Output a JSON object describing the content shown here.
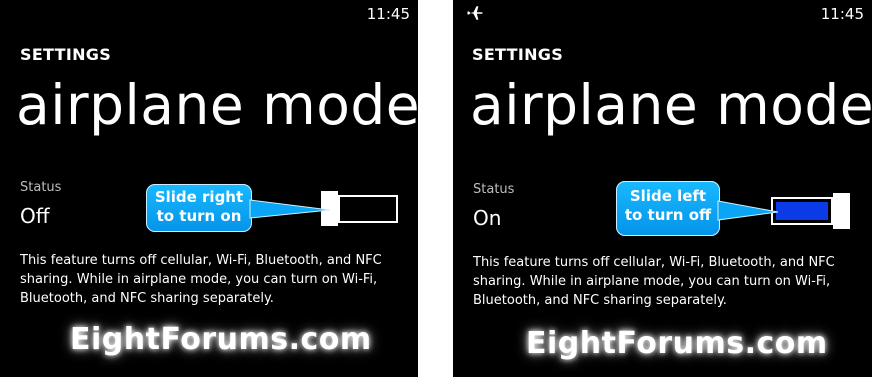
{
  "colors": {
    "background": "#000000",
    "text": "#ffffff",
    "accent_fill": "#0a3be6",
    "callout": "#0aa6f5"
  },
  "panels": [
    {
      "clock": "11:45",
      "show_airplane_icon": false,
      "header": "SETTINGS",
      "title": "airplane mode",
      "status_label": "Status",
      "status_value": "Off",
      "toggle_on": false,
      "callout_line1": "Slide right",
      "callout_line2": "to turn on",
      "description": "This feature turns off cellular, Wi-Fi, Bluetooth, and NFC sharing. While in airplane mode, you can turn on Wi-Fi, Bluetooth, and NFC sharing separately.",
      "watermark": "EightForums.com"
    },
    {
      "clock": "11:45",
      "show_airplane_icon": true,
      "status_icon": "airplane-icon",
      "header": "SETTINGS",
      "title": "airplane mode",
      "status_label": "Status",
      "status_value": "On",
      "toggle_on": true,
      "callout_line1": "Slide left",
      "callout_line2": "to turn off",
      "description": "This feature turns off cellular, Wi-Fi, Bluetooth, and NFC sharing. While in airplane mode, you can turn on Wi-Fi, Bluetooth, and NFC sharing separately.",
      "watermark": "EightForums.com"
    }
  ]
}
